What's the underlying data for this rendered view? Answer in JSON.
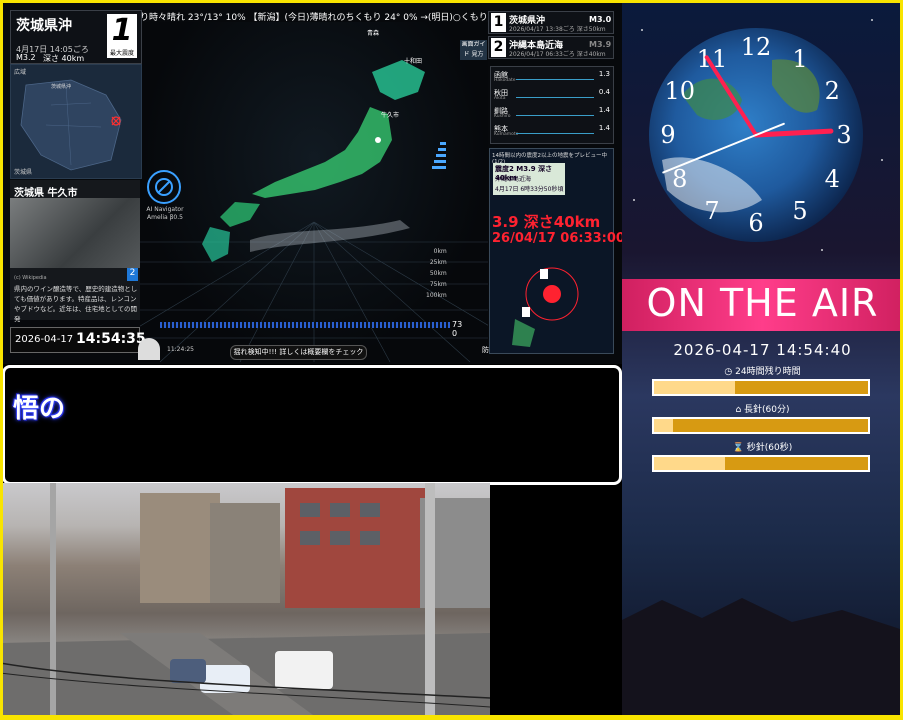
{
  "ticker": "り時々晴れ 23°/13° 10% 【新潟】(今日)薄晴れのちくもり 24° 0% →(明日)○くもり 19°/11° 20% 【富山",
  "main_quake": {
    "place": "茨城県沖",
    "time": "4月17日 14:05ごろ",
    "magnitude": "M3.2",
    "depth": "深さ 40km",
    "intensity": "1",
    "intensity_label": "最大震度"
  },
  "minimap": {
    "label_top": "広域",
    "label_city": "茨城県沖",
    "label_bottom": "茨城県"
  },
  "photo_card": {
    "title": "茨城県 牛久市",
    "credit": "(c) Wikipedia",
    "description": "県内のワイン醸造等で、歴史的建造物としても価値があります。特産品は、レンコンやブドウなど。近年は、住宅地としての開発",
    "badge": "2"
  },
  "clock_left": {
    "date": "2026-04-17",
    "time": "14:54:35"
  },
  "ai_navigator": {
    "line1": "AI Navigator",
    "line2": "Amelia β0.5"
  },
  "map_labels": {
    "a": "青森",
    "b": "牛久市",
    "c": "十和田"
  },
  "scale": [
    "0km",
    "25km",
    "50km",
    "75km",
    "100km"
  ],
  "bottom_button": "揺れ検知中!!! 詳しくは概要欄をチェック",
  "seismo": {
    "count_a": "73",
    "count_b": "0",
    "time": "11:24:25",
    "label": "防災科研"
  },
  "guide_button": "画面ガイド 見方",
  "recent": [
    {
      "num": "1",
      "name": "茨城県沖",
      "sub": "2026/04/17 13:38ごろ 深さ50km",
      "mag": "M3.0"
    },
    {
      "num": "2",
      "name": "沖縄本島近海",
      "sub": "2026/04/17 06:33ごろ 深さ40km",
      "mag": "M3.9"
    }
  ],
  "observations": [
    {
      "name": "函館",
      "sub": "Hakodate",
      "val": "1.3"
    },
    {
      "name": "秋田",
      "sub": "Akita",
      "val": "0.4"
    },
    {
      "name": "釧路",
      "sub": "Kushiro",
      "val": "1.4"
    },
    {
      "name": "熊本",
      "sub": "Kumamoto",
      "val": "1.4"
    }
  ],
  "preview": {
    "title": "14時間以内の震度2以上の地震をプレビュー中 (1/2)",
    "card_a": "震度2 M3.9 深さ40km",
    "card_b": "沖縄本島近海",
    "card_c": "4月17日 6時33分50秒頃",
    "red_line1": "3.9 深さ40km",
    "red_line2": "26/04/17 06:33:00"
  },
  "message": "悟の",
  "clock_numbers": [
    "12",
    "1",
    "2",
    "3",
    "4",
    "5",
    "6",
    "7",
    "8",
    "9",
    "10",
    "11"
  ],
  "clock_hands": {
    "hour": 2.9,
    "minute": 54.6,
    "second": 40
  },
  "on_air": "ON THE AIR",
  "datetime_right": "2026-04-17 14:54:40",
  "bars": [
    {
      "icon": "◷",
      "label": "24時間残り時間",
      "fill": 0.38
    },
    {
      "icon": "⌂",
      "label": "長針(60分)",
      "fill": 0.09
    },
    {
      "icon": "⌛",
      "label": "秒針(60秒)",
      "fill": 0.33
    }
  ],
  "colors": {
    "accent_yellow": "#f8e400",
    "onair_pink": "#ff3d8a",
    "bar_gold": "#d79a12"
  }
}
